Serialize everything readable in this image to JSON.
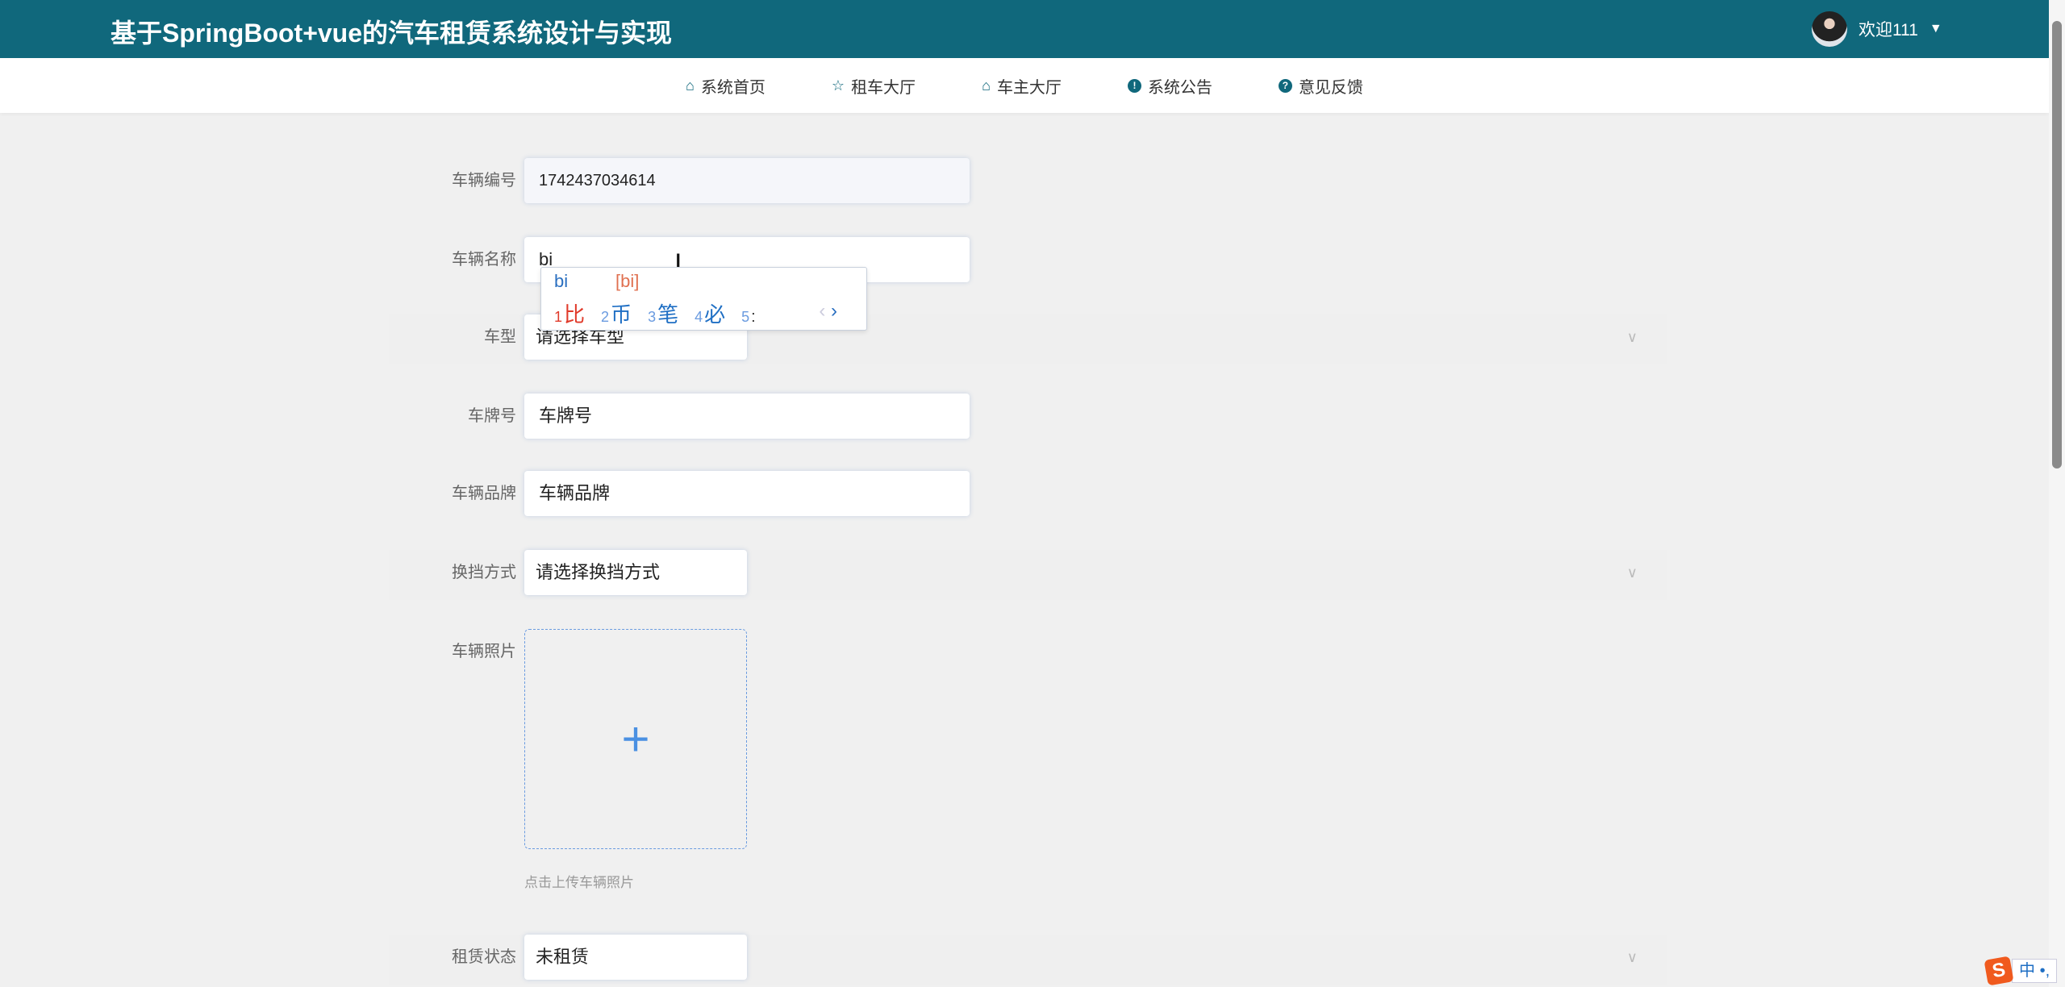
{
  "header": {
    "title": "基于SpringBoot+vue的汽车租赁系统设计与实现",
    "welcome": "欢迎111",
    "caret": "▼"
  },
  "nav": [
    {
      "label": "系统首页",
      "icon": "home-icon",
      "glyph": "⌂"
    },
    {
      "label": "租车大厅",
      "icon": "star-icon",
      "glyph": "☆"
    },
    {
      "label": "车主大厅",
      "icon": "bag-icon",
      "glyph": "⌂"
    },
    {
      "label": "系统公告",
      "icon": "info-circle-icon",
      "glyph": "!"
    },
    {
      "label": "意见反馈",
      "icon": "question-circle-icon",
      "glyph": "?"
    }
  ],
  "form": {
    "vehicle_no": {
      "label": "车辆编号",
      "value": "1742437034614"
    },
    "vehicle_name": {
      "label": "车辆名称",
      "value": "bi"
    },
    "vehicle_type": {
      "label": "车型",
      "placeholder": "请选择车型"
    },
    "plate": {
      "label": "车牌号",
      "placeholder": "车牌号"
    },
    "brand": {
      "label": "车辆品牌",
      "placeholder": "车辆品牌"
    },
    "gear": {
      "label": "换挡方式",
      "placeholder": "请选择换挡方式"
    },
    "photo": {
      "label": "车辆照片",
      "hint": "点击上传车辆照片"
    },
    "rent_status": {
      "label": "租赁状态",
      "value": "未租赁"
    }
  },
  "ime": {
    "composition": "bi",
    "pinyin": "[bi]",
    "candidates": [
      {
        "n": "1",
        "c": "比"
      },
      {
        "n": "2",
        "c": "币"
      },
      {
        "n": "3",
        "c": "笔"
      },
      {
        "n": "4",
        "c": "必"
      },
      {
        "n": "5",
        "c": ":"
      }
    ],
    "prev": "‹",
    "next": "›"
  },
  "taskbar": {
    "ime_mode": "中",
    "punct": "•,"
  },
  "colors": {
    "header": "#10687c",
    "accent": "#4a90e2"
  }
}
